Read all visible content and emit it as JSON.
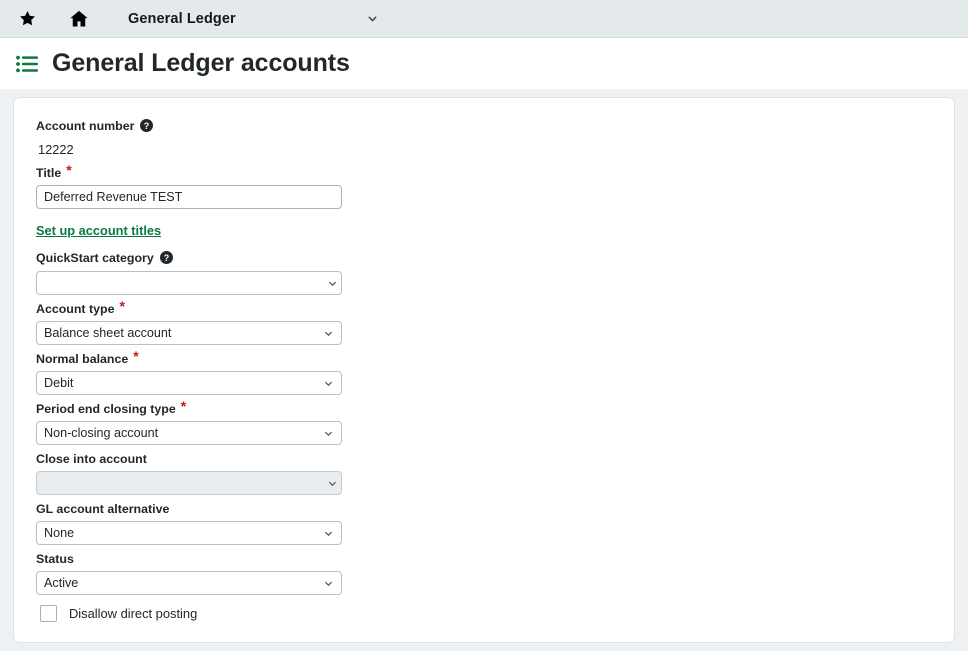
{
  "topbar": {
    "favorite_icon": "star-icon",
    "home_icon": "home-icon",
    "module_title": "General Ledger",
    "dropdown_icon": "chevron-down-icon"
  },
  "page": {
    "list_icon": "list-icon",
    "title": "General Ledger accounts"
  },
  "form": {
    "account_number": {
      "label": "Account number",
      "help_icon": "help-circle-icon",
      "value": "12222"
    },
    "title": {
      "label": "Title",
      "required_marker": "*",
      "value": "Deferred Revenue TEST",
      "placeholder": ""
    },
    "setup_link": {
      "label": "Set up account titles"
    },
    "quickstart_category": {
      "label": "QuickStart category",
      "help_icon": "help-circle-icon",
      "value": "",
      "chevron_icon": "chevron-down-icon"
    },
    "account_type": {
      "label": "Account type",
      "required_marker": "*",
      "value": "Balance sheet account",
      "chevron_icon": "chevron-down-icon"
    },
    "normal_balance": {
      "label": "Normal balance",
      "required_marker": "*",
      "value": "Debit",
      "chevron_icon": "chevron-down-icon"
    },
    "period_end_closing_type": {
      "label": "Period end closing type",
      "required_marker": "*",
      "value": "Non-closing account",
      "chevron_icon": "chevron-down-icon"
    },
    "close_into_account": {
      "label": "Close into account",
      "value": "",
      "chevron_icon": "chevron-down-icon"
    },
    "gl_account_alternative": {
      "label": "GL account alternative",
      "value": "None",
      "chevron_icon": "chevron-down-icon"
    },
    "status": {
      "label": "Status",
      "value": "Active",
      "chevron_icon": "chevron-down-icon"
    },
    "disallow_direct_posting": {
      "label": "Disallow direct posting",
      "checked": false
    }
  },
  "colors": {
    "accent_green": "#0a7a41",
    "required_red": "#c4161c",
    "topbar_bg": "#e4e9ec",
    "page_bg": "#eef1f3"
  }
}
